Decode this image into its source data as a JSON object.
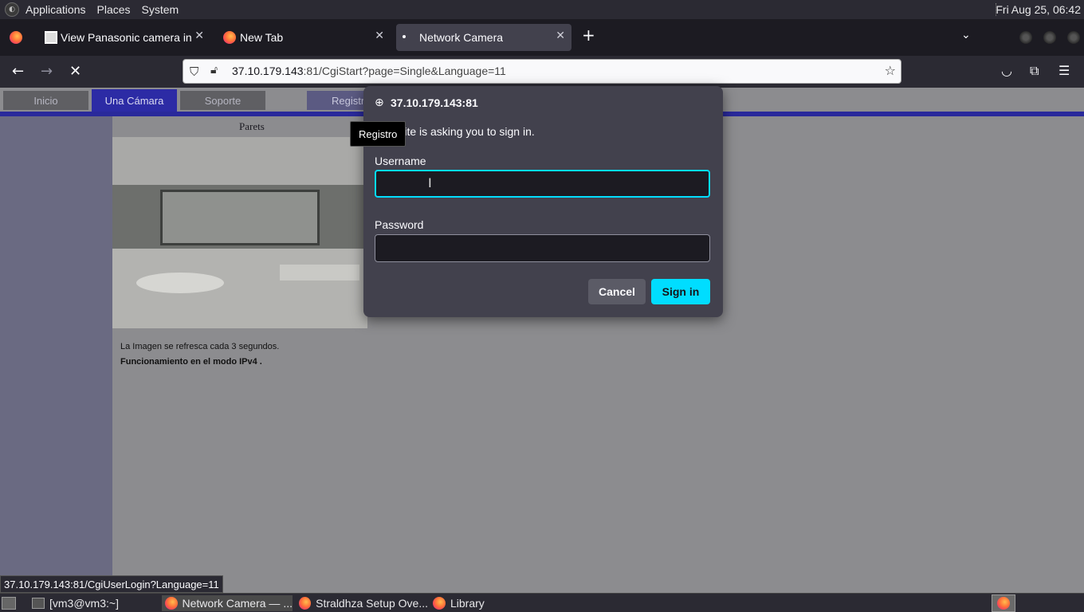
{
  "top_panel": {
    "menus": [
      "Applications",
      "Places",
      "System"
    ],
    "clock": "Fri Aug 25, 06:42"
  },
  "tabs": [
    {
      "title": "View Panasonic camera in Sp",
      "active": false
    },
    {
      "title": "New Tab",
      "active": false
    },
    {
      "title": "Network Camera",
      "active": true
    }
  ],
  "nav": {
    "url_host": "37.10.179.143",
    "url_rest": ":81/CgiStart?page=Single&Language=11"
  },
  "page": {
    "nav_items": [
      "Inicio",
      "Una Cámara",
      "Soporte",
      "Registro"
    ],
    "camera_label": "Parets",
    "refresh_text": "La Imagen se refresca cada 3 segundos.",
    "mode_text": "Funcionamiento en el modo IPv4 ."
  },
  "tooltip": "Registro",
  "auth_dialog": {
    "host": "37.10.179.143:81",
    "message": "This site is asking you to sign in.",
    "username_label": "Username",
    "username_value": "",
    "password_label": "Password",
    "password_value": "",
    "cancel_label": "Cancel",
    "signin_label": "Sign in"
  },
  "status_url": "37.10.179.143:81/CgiUserLogin?Language=11",
  "taskbar": {
    "items": [
      "[vm3@vm3:~]",
      "Network Camera — ...",
      "Straldhza Setup Ove...",
      "Library"
    ]
  }
}
